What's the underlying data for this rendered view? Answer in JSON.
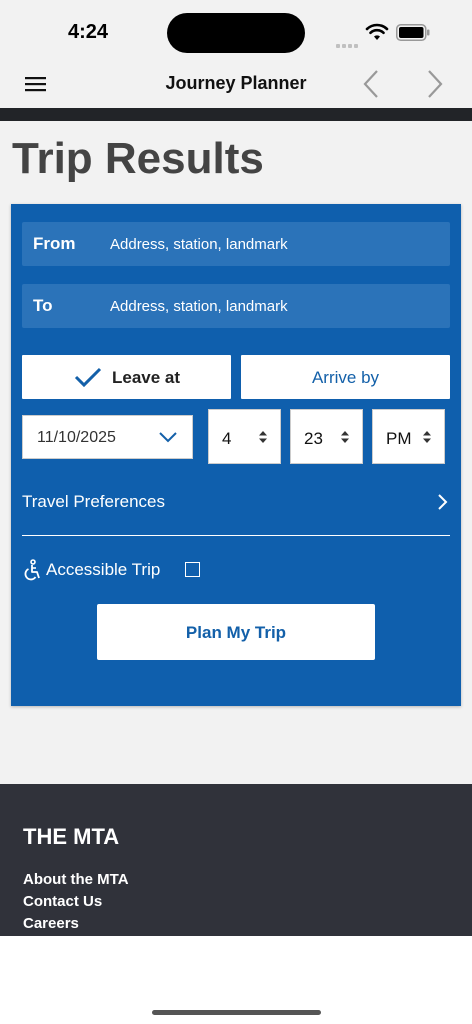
{
  "status_bar": {
    "time": "4:24"
  },
  "navbar": {
    "title": "Journey Planner"
  },
  "page": {
    "title": "Trip Results"
  },
  "planner": {
    "from": {
      "label": "From",
      "placeholder": "Address, station, landmark"
    },
    "to": {
      "label": "To",
      "placeholder": "Address, station, landmark"
    },
    "leave_label": "Leave at",
    "arrive_label": "Arrive by",
    "selected_mode": "Leave at",
    "date": "11/10/2025",
    "hour": "4",
    "minute": "23",
    "ampm": "PM",
    "travel_preferences": "Travel Preferences",
    "accessible_trip": "Accessible Trip",
    "accessible_checked": false,
    "plan_button": "Plan My Trip"
  },
  "footer": {
    "heading": "THE MTA",
    "links": [
      "About the MTA",
      "Contact Us",
      "Careers"
    ]
  },
  "colors": {
    "panel_blue": "#0f5fad",
    "field_blue": "#2b73b9",
    "accent_blue": "#1360a9",
    "footer_dark": "#30323a"
  }
}
